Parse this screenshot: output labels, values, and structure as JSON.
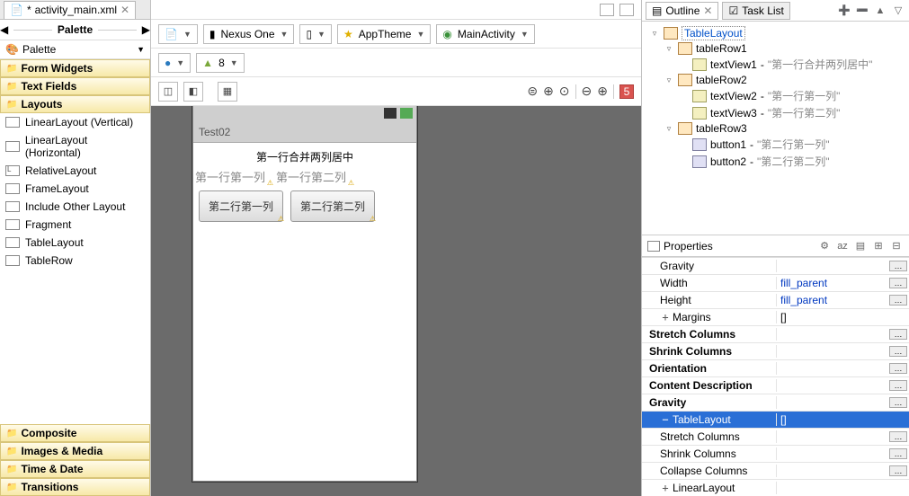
{
  "editor_tab": {
    "filename": "activity_main.xml",
    "dirty": "*"
  },
  "palette_title": "Palette",
  "palette_first_row": "Palette",
  "palette_groups": {
    "form_widgets": "Form Widgets",
    "text_fields": "Text Fields",
    "layouts": "Layouts",
    "composite": "Composite",
    "images_media": "Images & Media",
    "time_date": "Time & Date",
    "transitions": "Transitions"
  },
  "palette_items": {
    "linear_v": "LinearLayout (Vertical)",
    "linear_h": "LinearLayout (Horizontal)",
    "relative": "RelativeLayout",
    "frame": "FrameLayout",
    "include": "Include Other Layout",
    "fragment": "Fragment",
    "table_layout": "TableLayout",
    "table_row": "TableRow"
  },
  "config_bar": {
    "device": "Nexus One",
    "theme": "AppTheme",
    "activity": "MainActivity",
    "api": "8"
  },
  "zoom_badge": "5",
  "device_preview": {
    "app_title": "Test02",
    "row1_text": "第一行合并两列居中",
    "row2_c1": "第一行第一列",
    "row2_c2": "第一行第二列",
    "row3_b1": "第二行第一列",
    "row3_b2": "第二行第二列"
  },
  "outline": {
    "tab1": "Outline",
    "tab2": "Task List",
    "root": "TableLayout",
    "r1": "tableRow1",
    "r1_t": "textView1",
    "r1_t_d": "\"第一行合并两列居中\"",
    "r2": "tableRow2",
    "r2_t1": "textView2",
    "r2_t1_d": "\"第一行第一列\"",
    "r2_t2": "textView3",
    "r2_t2_d": "\"第一行第二列\"",
    "r3": "tableRow3",
    "r3_b1": "button1",
    "r3_b1_d": "\"第二行第一列\"",
    "r3_b2": "button2",
    "r3_b2_d": "\"第二行第二列\""
  },
  "properties": {
    "title": "Properties",
    "rows": {
      "gravity": "Gravity",
      "width": "Width",
      "width_v": "fill_parent",
      "height": "Height",
      "height_v": "fill_parent",
      "margins": "Margins",
      "margins_v": "[]",
      "stretch_cols": "Stretch Columns",
      "shrink_cols": "Shrink Columns",
      "orientation": "Orientation",
      "content_desc": "Content Description",
      "gravity2": "Gravity",
      "tablelayout": "TableLayout",
      "tablelayout_v": "[]",
      "tl_stretch": "Stretch Columns",
      "tl_shrink": "Shrink Columns",
      "tl_collapse": "Collapse Columns",
      "linearlayout": "LinearLayout"
    }
  }
}
